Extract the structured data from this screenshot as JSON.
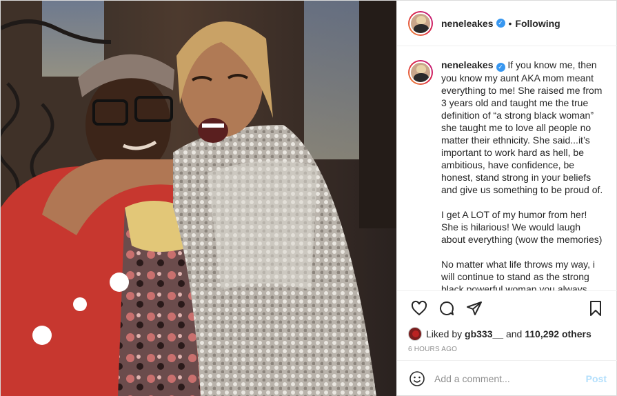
{
  "header": {
    "username": "neneleakes",
    "verified_icon": "verified-badge-icon",
    "separator": "•",
    "follow_status": "Following"
  },
  "caption": {
    "username": "neneleakes",
    "text": "If you know me, then you know my aunt AKA mom meant everything to me! She raised me from 3 years old and taught me the true definition of “a strong black woman” she taught me to love all people no matter their ethnicity. She said...it’s important to work hard as hell, be ambitious, have confidence, be honest, stand strong in your beliefs and give us something to be proud of.\n\nI get A LOT of my humor from her! She is hilarious! We would laugh about everything (wow the memories)\n\nNo matter what life throws my way, i will continue to stand as the strong black powerful woman you always taught me to be! Rest peacefully until"
  },
  "actions": {
    "icons": [
      "heart-icon",
      "comment-icon",
      "share-icon",
      "bookmark-icon"
    ]
  },
  "likes": {
    "prefix": "Liked by",
    "user": "gb333__",
    "and": "and",
    "count": "110,292 others"
  },
  "timestamp": "6 HOURS AGO",
  "comment": {
    "placeholder": "Add a comment...",
    "post_label": "Post"
  },
  "colors": {
    "verified": "#3897f0",
    "post_disabled": "#b2dffc",
    "muted": "#8e8e8e"
  }
}
